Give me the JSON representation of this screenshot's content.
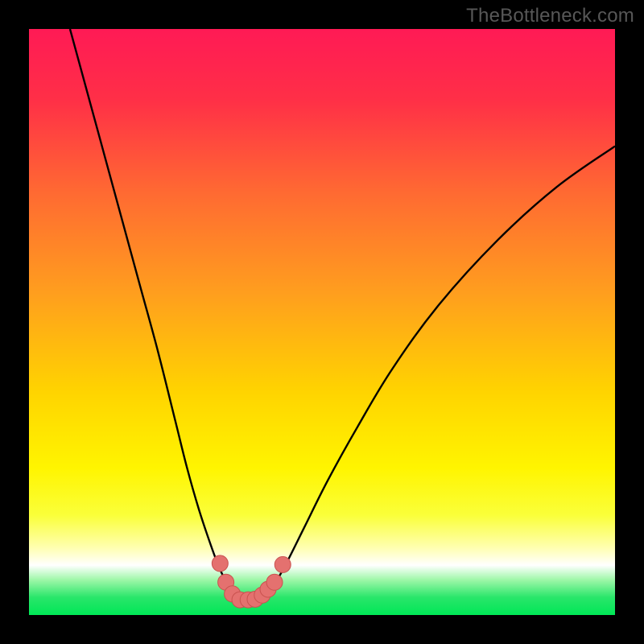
{
  "watermark": "TheBottleneck.com",
  "colors": {
    "bg_black": "#000000",
    "curve": "#000000",
    "marker_fill": "#e4716f",
    "marker_stroke": "#c9524f",
    "green_band": "#00e756"
  },
  "gradient_stops": [
    {
      "offset": 0.0,
      "color": "#ff1a55"
    },
    {
      "offset": 0.12,
      "color": "#ff2f47"
    },
    {
      "offset": 0.28,
      "color": "#ff6a32"
    },
    {
      "offset": 0.45,
      "color": "#ff9e1e"
    },
    {
      "offset": 0.62,
      "color": "#ffd400"
    },
    {
      "offset": 0.75,
      "color": "#fff500"
    },
    {
      "offset": 0.83,
      "color": "#faff3a"
    },
    {
      "offset": 0.885,
      "color": "#ffffb0"
    },
    {
      "offset": 0.915,
      "color": "#ffffff"
    },
    {
      "offset": 0.94,
      "color": "#9ef7a8"
    },
    {
      "offset": 0.97,
      "color": "#29e66a"
    },
    {
      "offset": 1.0,
      "color": "#00e756"
    }
  ],
  "chart_data": {
    "type": "line",
    "title": "",
    "xlabel": "",
    "ylabel": "",
    "xlim": [
      0,
      100
    ],
    "ylim": [
      0,
      100
    ],
    "series": [
      {
        "name": "bottleneck-curve",
        "x": [
          7,
          10,
          13,
          16,
          19,
          22,
          25,
          27,
          29,
          31,
          32.5,
          34,
          35,
          36,
          37,
          38.5,
          40,
          42,
          44,
          47,
          51,
          56,
          62,
          70,
          80,
          90,
          100
        ],
        "y": [
          100,
          89,
          78,
          67,
          56,
          45,
          33,
          25,
          18,
          12,
          8,
          5,
          3.3,
          2.6,
          2.4,
          2.6,
          3.3,
          5.5,
          9,
          15,
          23,
          32,
          42,
          53,
          64,
          73,
          80
        ]
      }
    ],
    "markers": {
      "name": "highlight-points",
      "points": [
        {
          "x": 32.6,
          "y": 8.8
        },
        {
          "x": 33.6,
          "y": 5.6
        },
        {
          "x": 34.7,
          "y": 3.6
        },
        {
          "x": 36.0,
          "y": 2.6
        },
        {
          "x": 37.4,
          "y": 2.6
        },
        {
          "x": 38.6,
          "y": 2.7
        },
        {
          "x": 39.8,
          "y": 3.4
        },
        {
          "x": 40.8,
          "y": 4.4
        },
        {
          "x": 41.9,
          "y": 5.6
        },
        {
          "x": 43.3,
          "y": 8.6
        }
      ],
      "radius": 10
    }
  }
}
